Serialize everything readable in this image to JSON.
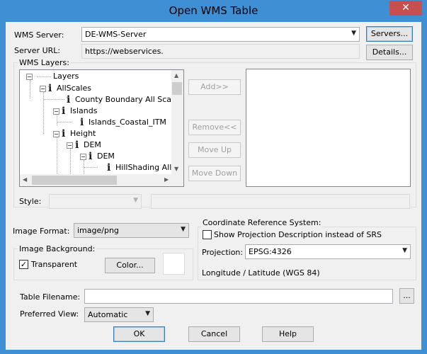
{
  "window": {
    "title": "Open WMS Table",
    "close_glyph": "✕"
  },
  "server": {
    "label": "WMS Server:",
    "value": "DE-WMS-Server",
    "servers_button": "Servers...",
    "url_label": "Server URL:",
    "url_value": "https://webservices.",
    "details_button": "Details..."
  },
  "layers": {
    "label": "WMS Layers:",
    "tree": [
      {
        "label": "Layers",
        "expander": "−",
        "icon": "none"
      },
      {
        "label": "AllScales",
        "expander": "−",
        "icon": "info-icon"
      },
      {
        "label": "County Boundary All Scales",
        "expander": "",
        "icon": "info-icon"
      },
      {
        "label": "Islands",
        "expander": "−",
        "icon": "info-icon"
      },
      {
        "label": "Islands_Coastal_ITM",
        "expander": "",
        "icon": "info-icon"
      },
      {
        "label": "Height",
        "expander": "−",
        "icon": "info-icon"
      },
      {
        "label": "DEM",
        "expander": "−",
        "icon": "info-icon"
      },
      {
        "label": "DEM",
        "expander": "−",
        "icon": "info-icon"
      },
      {
        "label": "HillShading All S",
        "expander": "",
        "icon": "info-icon"
      }
    ],
    "info_glyph": "i",
    "add_button": "Add>>",
    "remove_button": "Remove<<",
    "move_up_button": "Move Up",
    "move_down_button": "Move Down"
  },
  "style": {
    "label": "Style:",
    "value": "",
    "text": ""
  },
  "image_format": {
    "label": "Image Format:",
    "value": "image/png"
  },
  "background": {
    "label": "Image Background:",
    "transparent_label": "Transparent",
    "transparent_checked": true,
    "check_glyph": "✓",
    "color_button": "Color..."
  },
  "crs": {
    "label": "Coordinate Reference System:",
    "show_desc_label": "Show Projection Description instead of SRS",
    "show_desc_checked": false,
    "projection_label": "Projection:",
    "projection_value": "EPSG:4326",
    "description": "Longitude / Latitude (WGS 84)"
  },
  "table": {
    "filename_label": "Table Filename:",
    "filename_value": "",
    "browse_button": "..."
  },
  "preferred_view": {
    "label": "Preferred View:",
    "value": "Automatic"
  },
  "footer": {
    "ok": "OK",
    "cancel": "Cancel",
    "help": "Help"
  },
  "glyphs": {
    "dropdown": "▼",
    "arrow_up": "▲",
    "arrow_down": "▼",
    "arrow_left": "◀",
    "arrow_right": "▶"
  },
  "colors": {
    "titlebar": "#3f8fd5",
    "close": "#c74f50",
    "dialog": "#f0f0f0"
  }
}
